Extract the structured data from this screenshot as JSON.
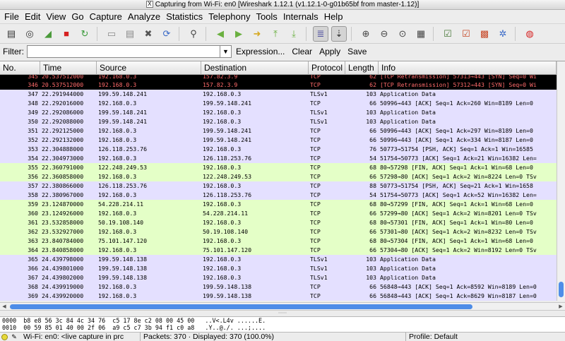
{
  "window": {
    "title": "Capturing from Wi-Fi: en0   [Wireshark 1.12.1  (v1.12.1-0-g01b65bf from master-1.12)]"
  },
  "menu": [
    "File",
    "Edit",
    "View",
    "Go",
    "Capture",
    "Analyze",
    "Statistics",
    "Telephony",
    "Tools",
    "Internals",
    "Help"
  ],
  "toolbar": [
    "interfaces-icon",
    "options-icon",
    "start-capture-icon",
    "stop-capture-icon",
    "restart-capture-icon",
    "open-file-icon",
    "save-file-icon",
    "close-file-icon",
    "reload-icon",
    "find-icon",
    "go-back-icon",
    "go-forward-icon",
    "go-to-packet-icon",
    "go-first-icon",
    "go-last-icon",
    "colorize-icon",
    "autoscroll-icon",
    "zoom-in-icon",
    "zoom-out-icon",
    "normal-size-icon",
    "resize-columns-icon",
    "capture-filters-icon",
    "display-filters-icon",
    "coloring-rules-icon",
    "preferences-icon",
    "help-icon"
  ],
  "filter": {
    "label": "Filter:",
    "value": "",
    "buttons": [
      "Expression...",
      "Clear",
      "Apply",
      "Save"
    ]
  },
  "columns": [
    "No.",
    "Time",
    "Source",
    "Destination",
    "Protocol",
    "Length",
    "Info"
  ],
  "colors": {
    "black": "#000000",
    "black_fg": "#ff6b6b",
    "purple": "#e4e0ff",
    "green": "#e4ffc7",
    "white": "#ffffff"
  },
  "packets": [
    {
      "no": "345",
      "time": "20.537512000",
      "src": "192.168.0.3",
      "dst": "157.82.3.9",
      "proto": "TCP",
      "len": "62",
      "info": "[TCP Retransmission] 57313→443 [SYN] Seq=0 Wi",
      "color": "black"
    },
    {
      "no": "346",
      "time": "20.537512000",
      "src": "192.168.0.3",
      "dst": "157.82.3.9",
      "proto": "TCP",
      "len": "62",
      "info": "[TCP Retransmission] 57312→443 [SYN] Seq=0 Wi",
      "color": "black"
    },
    {
      "no": "347",
      "time": "22.291944000",
      "src": "199.59.148.241",
      "dst": "192.168.0.3",
      "proto": "TLSv1",
      "len": "103",
      "info": "Application Data",
      "color": "purple"
    },
    {
      "no": "348",
      "time": "22.292016000",
      "src": "192.168.0.3",
      "dst": "199.59.148.241",
      "proto": "TCP",
      "len": "66",
      "info": "50996→443 [ACK] Seq=1 Ack=260 Win=8189 Len=0",
      "color": "purple"
    },
    {
      "no": "349",
      "time": "22.292086000",
      "src": "199.59.148.241",
      "dst": "192.168.0.3",
      "proto": "TLSv1",
      "len": "103",
      "info": "Application Data",
      "color": "purple"
    },
    {
      "no": "350",
      "time": "22.292088000",
      "src": "199.59.148.241",
      "dst": "192.168.0.3",
      "proto": "TLSv1",
      "len": "103",
      "info": "Application Data",
      "color": "purple"
    },
    {
      "no": "351",
      "time": "22.292125000",
      "src": "192.168.0.3",
      "dst": "199.59.148.241",
      "proto": "TCP",
      "len": "66",
      "info": "50996→443 [ACK] Seq=1 Ack=297 Win=8189 Len=0",
      "color": "purple"
    },
    {
      "no": "352",
      "time": "22.292132000",
      "src": "192.168.0.3",
      "dst": "199.59.148.241",
      "proto": "TCP",
      "len": "66",
      "info": "50996→443 [ACK] Seq=1 Ack=334 Win=8187 Len=0",
      "color": "purple"
    },
    {
      "no": "353",
      "time": "22.304888000",
      "src": "126.118.253.76",
      "dst": "192.168.0.3",
      "proto": "TCP",
      "len": "76",
      "info": "50773→51754 [PSH, ACK] Seq=1 Ack=1 Win=16585",
      "color": "purple"
    },
    {
      "no": "354",
      "time": "22.304973000",
      "src": "192.168.0.3",
      "dst": "126.118.253.76",
      "proto": "TCP",
      "len": "54",
      "info": "51754→50773 [ACK] Seq=1 Ack=21 Win=16382 Len=",
      "color": "purple"
    },
    {
      "no": "355",
      "time": "22.360791000",
      "src": "122.248.249.53",
      "dst": "192.168.0.3",
      "proto": "TCP",
      "len": "68",
      "info": "80→57298 [FIN, ACK] Seq=1 Ack=1 Win=68 Len=0",
      "color": "green"
    },
    {
      "no": "356",
      "time": "22.360858000",
      "src": "192.168.0.3",
      "dst": "122.248.249.53",
      "proto": "TCP",
      "len": "66",
      "info": "57298→80 [ACK] Seq=1 Ack=2 Win=8224 Len=0 TSv",
      "color": "green"
    },
    {
      "no": "357",
      "time": "22.380866000",
      "src": "126.118.253.76",
      "dst": "192.168.0.3",
      "proto": "TCP",
      "len": "88",
      "info": "50773→51754 [PSH, ACK] Seq=21 Ack=1 Win=1658",
      "color": "purple"
    },
    {
      "no": "358",
      "time": "22.380967000",
      "src": "192.168.0.3",
      "dst": "126.118.253.76",
      "proto": "TCP",
      "len": "54",
      "info": "51754→50773 [ACK] Seq=1 Ack=52 Win=16382 Len=",
      "color": "purple"
    },
    {
      "no": "359",
      "time": "23.124870000",
      "src": "54.228.214.11",
      "dst": "192.168.0.3",
      "proto": "TCP",
      "len": "68",
      "info": "80→57299 [FIN, ACK] Seq=1 Ack=1 Win=68 Len=0",
      "color": "green"
    },
    {
      "no": "360",
      "time": "23.124926000",
      "src": "192.168.0.3",
      "dst": "54.228.214.11",
      "proto": "TCP",
      "len": "66",
      "info": "57299→80 [ACK] Seq=1 Ack=2 Win=8201 Len=0 TSv",
      "color": "green"
    },
    {
      "no": "361",
      "time": "23.532858000",
      "src": "50.19.108.140",
      "dst": "192.168.0.3",
      "proto": "TCP",
      "len": "68",
      "info": "80→57301 [FIN, ACK] Seq=1 Ack=1 Win=80 Len=0",
      "color": "green"
    },
    {
      "no": "362",
      "time": "23.532927000",
      "src": "192.168.0.3",
      "dst": "50.19.108.140",
      "proto": "TCP",
      "len": "66",
      "info": "57301→80 [ACK] Seq=1 Ack=2 Win=8232 Len=0 TSv",
      "color": "green"
    },
    {
      "no": "363",
      "time": "23.840784000",
      "src": "75.101.147.120",
      "dst": "192.168.0.3",
      "proto": "TCP",
      "len": "68",
      "info": "80→57304 [FIN, ACK] Seq=1 Ack=1 Win=68 Len=0",
      "color": "green"
    },
    {
      "no": "364",
      "time": "23.840858000",
      "src": "192.168.0.3",
      "dst": "75.101.147.120",
      "proto": "TCP",
      "len": "66",
      "info": "57304→80 [ACK] Seq=1 Ack=2 Win=8192 Len=0 TSv",
      "color": "green"
    },
    {
      "no": "365",
      "time": "24.439798000",
      "src": "199.59.148.138",
      "dst": "192.168.0.3",
      "proto": "TLSv1",
      "len": "103",
      "info": "Application Data",
      "color": "purple"
    },
    {
      "no": "366",
      "time": "24.439801000",
      "src": "199.59.148.138",
      "dst": "192.168.0.3",
      "proto": "TLSv1",
      "len": "103",
      "info": "Application Data",
      "color": "purple"
    },
    {
      "no": "367",
      "time": "24.439802000",
      "src": "199.59.148.138",
      "dst": "192.168.0.3",
      "proto": "TLSv1",
      "len": "103",
      "info": "Application Data",
      "color": "purple"
    },
    {
      "no": "368",
      "time": "24.439919000",
      "src": "192.168.0.3",
      "dst": "199.59.148.138",
      "proto": "TCP",
      "len": "66",
      "info": "56848→443 [ACK] Seq=1 Ack=8592 Win=8189 Len=0",
      "color": "purple"
    },
    {
      "no": "369",
      "time": "24.439920000",
      "src": "192.168.0.3",
      "dst": "199.59.148.138",
      "proto": "TCP",
      "len": "66",
      "info": "56848→443 [ACK] Seq=1 Ack=8629 Win=8187 Len=0",
      "color": "purple"
    },
    {
      "no": "370",
      "time": "24.439989000",
      "src": "192.168.0.3",
      "dst": "199.59.148.138",
      "proto": "TCP",
      "len": "66",
      "info": "56848→443 [ACK] Seq=1 Ack=8666 Win=8185 Len=0",
      "color": "purple"
    }
  ],
  "bytes": [
    "0000  b8 e8 56 3c 84 4c 34 76  c5 17 8e c2 08 00 45 00   ..V<.L4v ......E.",
    "0010  00 59 85 01 40 00 2f 06  a9 c5 c7 3b 94 f1 c0 a8   .Y..@./. ...;...."
  ],
  "status": {
    "interface": "Wi-Fi: en0: <live capture in prc",
    "packets": "Packets: 370 · Displayed: 370 (100.0%)",
    "profile": "Profile: Default"
  }
}
